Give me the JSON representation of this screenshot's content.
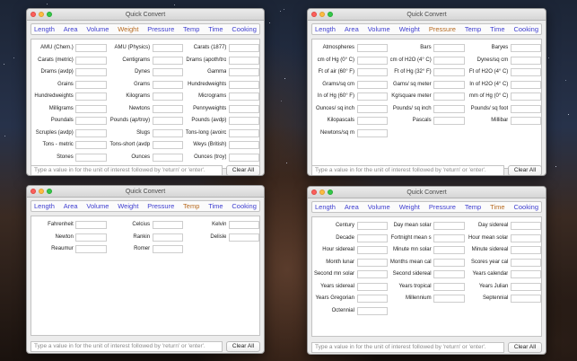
{
  "windows": [
    {
      "title": "Quick Convert",
      "tabs": [
        "Length",
        "Area",
        "Volume",
        "Weight",
        "Pressure",
        "Temp",
        "Time",
        "Cooking"
      ],
      "active_tab": "Weight",
      "rows": [
        [
          "AMU (Chem.)",
          "AMU (Physics)",
          "Carats (1877)"
        ],
        [
          "Carats (metric)",
          "Centigrams",
          "Drams (apoth/tro"
        ],
        [
          "Drams (avdp)",
          "Dynes",
          "Gamma"
        ],
        [
          "Grains",
          "Grams",
          "Hundredweights"
        ],
        [
          "Hundredweights",
          "Kilograms",
          "Micrograms"
        ],
        [
          "Milligrams",
          "Newtons",
          "Pennyweights"
        ],
        [
          "Poundals",
          "Pounds (ap/troy)",
          "Pounds (avdp)"
        ],
        [
          "Scruples (avdp)",
          "Slugs",
          "Tons-long (avoirc"
        ],
        [
          "Tons - metric",
          "Tons-short (avdp",
          "Weys (British)"
        ],
        [
          "Stones",
          "Ounces",
          "Ounces (troy)"
        ]
      ],
      "placeholder": "Type a value in for the unit of interest followed by 'return' or 'enter'.",
      "clear_label": "Clear All"
    },
    {
      "title": "Quick Convert",
      "tabs": [
        "Length",
        "Area",
        "Volume",
        "Weight",
        "Pressure",
        "Temp",
        "Time",
        "Cooking"
      ],
      "active_tab": "Pressure",
      "rows": [
        [
          "Atmospheres",
          "Bars",
          "Baryes"
        ],
        [
          "cm of Hg (0° C)",
          "cm of H2O (4° C)",
          "Dynes/sq cm"
        ],
        [
          "Ft of air (60° F)",
          "Ft of Hg (32° F)",
          "Ft of H2O (4° C)"
        ],
        [
          "Grams/sq cm",
          "Gams/ sq meter",
          "In of H2O (4° C)"
        ],
        [
          "In of Hg (60° F)",
          "Kg/square meter",
          "mm of Hg (0° C)"
        ],
        [
          "Ounces/ sq inch",
          "Pounds/ sq inch",
          "Pounds/ sq foot"
        ],
        [
          "Kilopascals",
          "Pascals",
          "Millibar"
        ],
        [
          "Newtons/sq m",
          "",
          ""
        ]
      ],
      "placeholder": "Type a value in for the unit of interest followed by 'return' or 'enter'.",
      "clear_label": "Clear All"
    },
    {
      "title": "Quick Convert",
      "tabs": [
        "Length",
        "Area",
        "Volume",
        "Weight",
        "Pressure",
        "Temp",
        "Time",
        "Cooking"
      ],
      "active_tab": "Temp",
      "rows": [
        [
          "Fahrenheit",
          "Celcius",
          "Kelvin"
        ],
        [
          "Newton",
          "Rankin",
          "Delisle"
        ],
        [
          "Reaumur",
          "Romer",
          ""
        ]
      ],
      "placeholder": "Type a value in for the unit of interest followed by 'return' or 'enter'.",
      "clear_label": "Clear All"
    },
    {
      "title": "Quick Convert",
      "tabs": [
        "Length",
        "Area",
        "Volume",
        "Weight",
        "Pressure",
        "Temp",
        "Time",
        "Cooking"
      ],
      "active_tab": "Time",
      "rows": [
        [
          "Century",
          "Day mean solar",
          "Day sidereal"
        ],
        [
          "Decade",
          "Fortnight mean s",
          "Hour mean solar"
        ],
        [
          "Hour sidereal",
          "Minute mn solar",
          "Minute sidereal"
        ],
        [
          "Month lunar",
          "Months mean cal",
          "Scores year cal"
        ],
        [
          "Second mn solar",
          "Second sidereal",
          "Years calendar"
        ],
        [
          "Years sidereal",
          "Years tropical",
          "Years Julian"
        ],
        [
          "Years Gregorian",
          "Millennium",
          "Septennial"
        ],
        [
          "Octennial",
          "",
          ""
        ]
      ],
      "placeholder": "Type a value in for the unit of interest followed by 'return' or 'enter'.",
      "clear_label": "Clear All"
    }
  ]
}
